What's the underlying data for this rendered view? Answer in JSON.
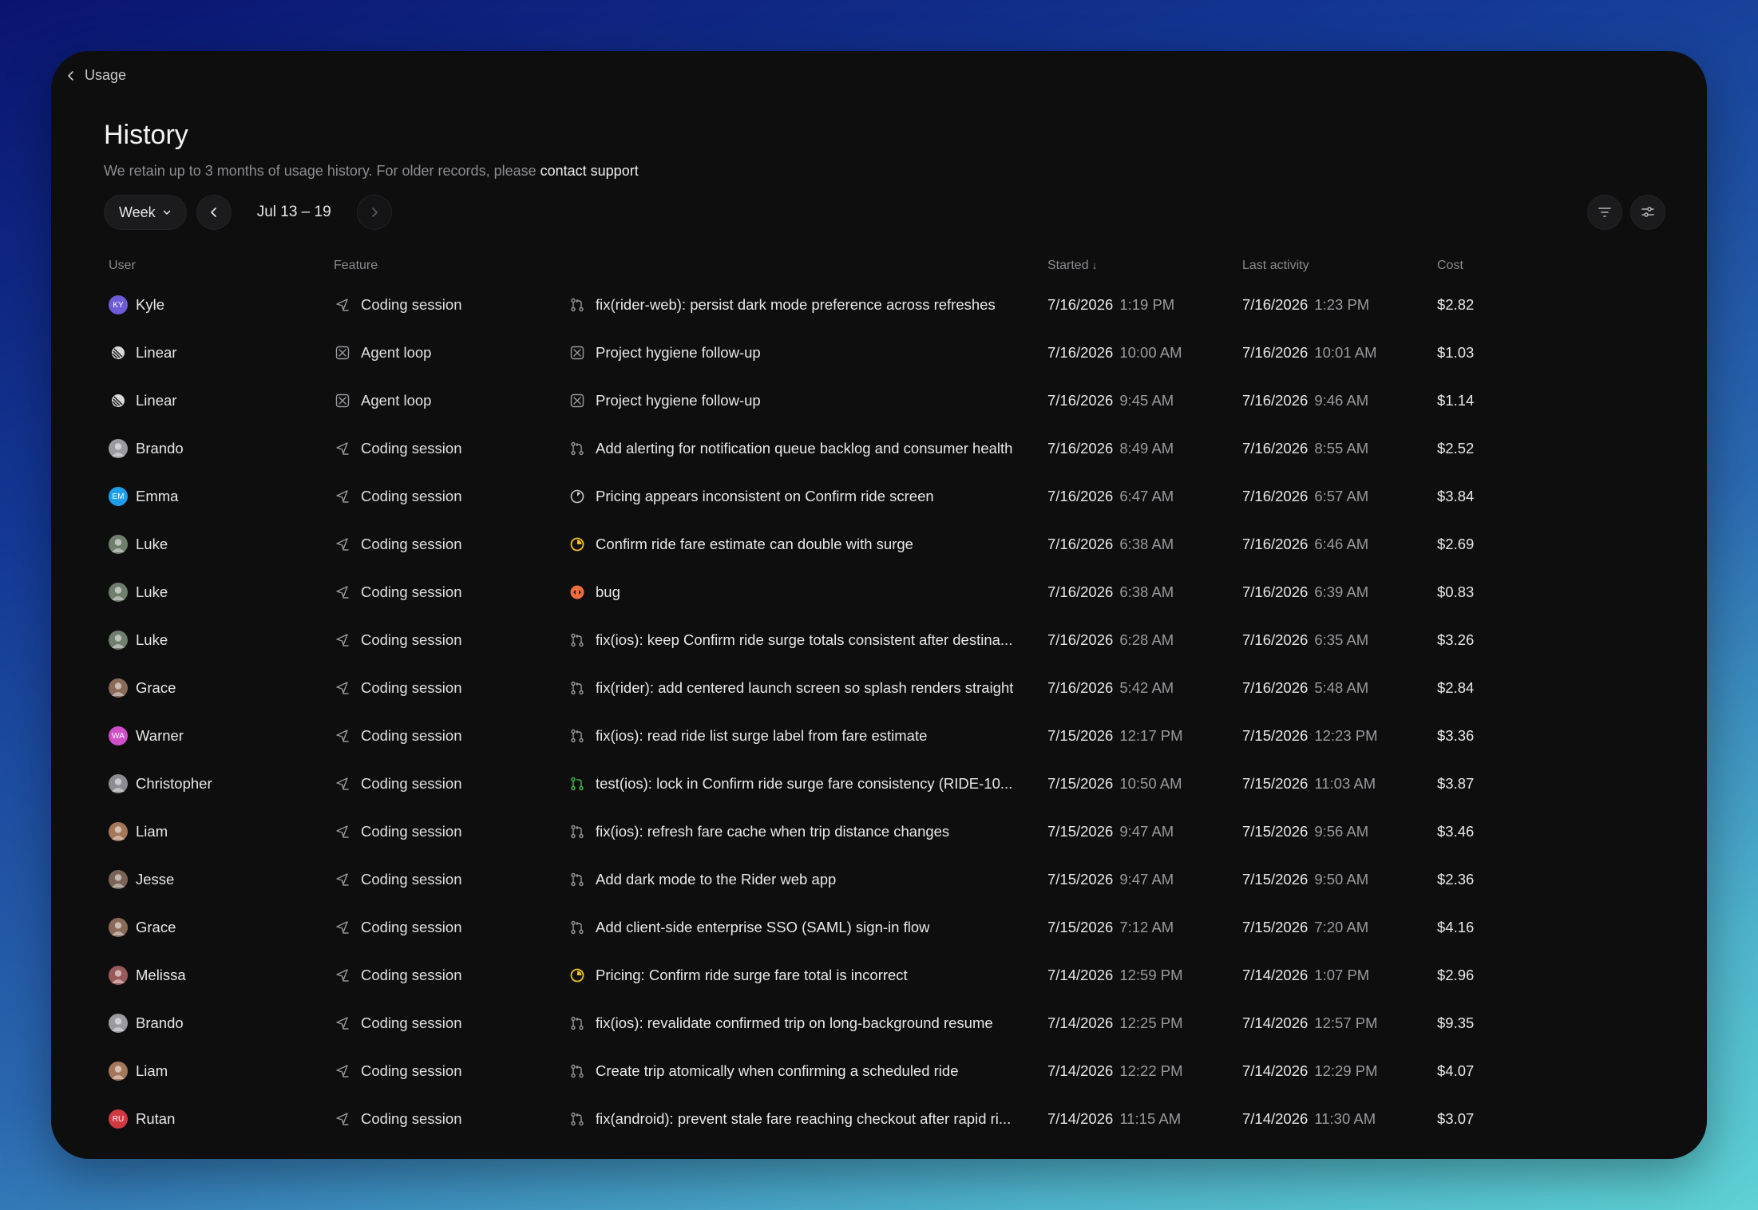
{
  "breadcrumb": {
    "label": "Usage"
  },
  "header": {
    "title": "History",
    "subtitle": "We retain up to 3 months of usage history. For older records, please",
    "link": "contact support"
  },
  "toolbar": {
    "period": "Week",
    "range": "Jul 13 – 19"
  },
  "columns": {
    "user": "User",
    "feature": "Feature",
    "started": "Started",
    "started_sort": "↓",
    "last": "Last activity",
    "cost": "Cost"
  },
  "rows": [
    {
      "user": "Kyle",
      "avatar": {
        "type": "initials",
        "text": "KY",
        "color": "#6e5bd6"
      },
      "feature": "Coding session",
      "feature_icon": "coding-icon",
      "title_icon": "pull-request-icon",
      "title": "fix(rider-web): persist dark mode preference across refreshes",
      "started_date": "7/16/2026",
      "started_time": "1:19 PM",
      "last_date": "7/16/2026",
      "last_time": "1:23 PM",
      "cost": "$2.82"
    },
    {
      "user": "Linear",
      "avatar": {
        "type": "logo",
        "text": "",
        "color": "#d8d8da"
      },
      "feature": "Agent loop",
      "feature_icon": "agent-loop-icon",
      "title_icon": "agent-loop-icon",
      "title": "Project hygiene follow-up",
      "started_date": "7/16/2026",
      "started_time": "10:00 AM",
      "last_date": "7/16/2026",
      "last_time": "10:01 AM",
      "cost": "$1.03"
    },
    {
      "user": "Linear",
      "avatar": {
        "type": "logo",
        "text": "",
        "color": "#d8d8da"
      },
      "feature": "Agent loop",
      "feature_icon": "agent-loop-icon",
      "title_icon": "agent-loop-icon",
      "title": "Project hygiene follow-up",
      "started_date": "7/16/2026",
      "started_time": "9:45 AM",
      "last_date": "7/16/2026",
      "last_time": "9:46 AM",
      "cost": "$1.14"
    },
    {
      "user": "Brando",
      "avatar": {
        "type": "photo",
        "text": "",
        "color": "#9a9aa0"
      },
      "feature": "Coding session",
      "feature_icon": "coding-icon",
      "title_icon": "pull-request-icon",
      "title": "Add alerting for notification queue backlog and consumer health",
      "started_date": "7/16/2026",
      "started_time": "8:49 AM",
      "last_date": "7/16/2026",
      "last_time": "8:55 AM",
      "cost": "$2.52"
    },
    {
      "user": "Emma",
      "avatar": {
        "type": "initials",
        "text": "EM",
        "color": "#1e9ee8"
      },
      "feature": "Coding session",
      "feature_icon": "coding-icon",
      "title_icon": "issue-open-icon",
      "title": "Pricing appears inconsistent on Confirm ride screen",
      "started_date": "7/16/2026",
      "started_time": "6:47 AM",
      "last_date": "7/16/2026",
      "last_time": "6:57 AM",
      "cost": "$3.84"
    },
    {
      "user": "Luke",
      "avatar": {
        "type": "photo",
        "text": "",
        "color": "#6f7f6c"
      },
      "feature": "Coding session",
      "feature_icon": "coding-icon",
      "title_icon": "issue-progress-icon",
      "title": "Confirm ride fare estimate can double with surge",
      "started_date": "7/16/2026",
      "started_time": "6:38 AM",
      "last_date": "7/16/2026",
      "last_time": "6:46 AM",
      "cost": "$2.69"
    },
    {
      "user": "Luke",
      "avatar": {
        "type": "photo",
        "text": "",
        "color": "#6f7f6c"
      },
      "feature": "Coding session",
      "feature_icon": "coding-icon",
      "title_icon": "urgent-issue-icon",
      "title": "bug",
      "started_date": "7/16/2026",
      "started_time": "6:38 AM",
      "last_date": "7/16/2026",
      "last_time": "6:39 AM",
      "cost": "$0.83"
    },
    {
      "user": "Luke",
      "avatar": {
        "type": "photo",
        "text": "",
        "color": "#6f7f6c"
      },
      "feature": "Coding session",
      "feature_icon": "coding-icon",
      "title_icon": "pull-request-icon",
      "title": "fix(ios): keep Confirm ride surge totals consistent after destina...",
      "started_date": "7/16/2026",
      "started_time": "6:28 AM",
      "last_date": "7/16/2026",
      "last_time": "6:35 AM",
      "cost": "$3.26"
    },
    {
      "user": "Grace",
      "avatar": {
        "type": "photo",
        "text": "",
        "color": "#8a6a58"
      },
      "feature": "Coding session",
      "feature_icon": "coding-icon",
      "title_icon": "pull-request-icon",
      "title": "fix(rider): add centered launch screen so splash renders straight",
      "started_date": "7/16/2026",
      "started_time": "5:42 AM",
      "last_date": "7/16/2026",
      "last_time": "5:48 AM",
      "cost": "$2.84"
    },
    {
      "user": "Warner",
      "avatar": {
        "type": "initials",
        "text": "WA",
        "color": "#d04ec8"
      },
      "feature": "Coding session",
      "feature_icon": "coding-icon",
      "title_icon": "pull-request-icon",
      "title": "fix(ios): read ride list surge label from fare estimate",
      "started_date": "7/15/2026",
      "started_time": "12:17 PM",
      "last_date": "7/15/2026",
      "last_time": "12:23 PM",
      "cost": "$3.36"
    },
    {
      "user": "Christopher",
      "avatar": {
        "type": "photo",
        "text": "",
        "color": "#8c8c92"
      },
      "feature": "Coding session",
      "feature_icon": "coding-icon",
      "title_icon": "pull-request-merged-icon",
      "title": "test(ios): lock in Confirm ride surge fare consistency (RIDE-10...",
      "started_date": "7/15/2026",
      "started_time": "10:50 AM",
      "last_date": "7/15/2026",
      "last_time": "11:03 AM",
      "cost": "$3.87"
    },
    {
      "user": "Liam",
      "avatar": {
        "type": "photo",
        "text": "",
        "color": "#a4765a"
      },
      "feature": "Coding session",
      "feature_icon": "coding-icon",
      "title_icon": "pull-request-icon",
      "title": "fix(ios): refresh fare cache when trip distance changes",
      "started_date": "7/15/2026",
      "started_time": "9:47 AM",
      "last_date": "7/15/2026",
      "last_time": "9:56 AM",
      "cost": "$3.46"
    },
    {
      "user": "Jesse",
      "avatar": {
        "type": "photo",
        "text": "",
        "color": "#7a6458"
      },
      "feature": "Coding session",
      "feature_icon": "coding-icon",
      "title_icon": "pull-request-icon",
      "title": "Add dark mode to the Rider web app",
      "started_date": "7/15/2026",
      "started_time": "9:47 AM",
      "last_date": "7/15/2026",
      "last_time": "9:50 AM",
      "cost": "$2.36"
    },
    {
      "user": "Grace",
      "avatar": {
        "type": "photo",
        "text": "",
        "color": "#8a6a58"
      },
      "feature": "Coding session",
      "feature_icon": "coding-icon",
      "title_icon": "pull-request-icon",
      "title": "Add client-side enterprise SSO (SAML) sign-in flow",
      "started_date": "7/15/2026",
      "started_time": "7:12 AM",
      "last_date": "7/15/2026",
      "last_time": "7:20 AM",
      "cost": "$4.16"
    },
    {
      "user": "Melissa",
      "avatar": {
        "type": "photo",
        "text": "",
        "color": "#9a5a5a"
      },
      "feature": "Coding session",
      "feature_icon": "coding-icon",
      "title_icon": "issue-progress-icon",
      "title": "Pricing: Confirm ride surge fare total is incorrect",
      "started_date": "7/14/2026",
      "started_time": "12:59 PM",
      "last_date": "7/14/2026",
      "last_time": "1:07 PM",
      "cost": "$2.96"
    },
    {
      "user": "Brando",
      "avatar": {
        "type": "photo",
        "text": "",
        "color": "#9a9aa0"
      },
      "feature": "Coding session",
      "feature_icon": "coding-icon",
      "title_icon": "pull-request-icon",
      "title": "fix(ios): revalidate confirmed trip on long-background resume",
      "started_date": "7/14/2026",
      "started_time": "12:25 PM",
      "last_date": "7/14/2026",
      "last_time": "12:57 PM",
      "cost": "$9.35"
    },
    {
      "user": "Liam",
      "avatar": {
        "type": "photo",
        "text": "",
        "color": "#a4765a"
      },
      "feature": "Coding session",
      "feature_icon": "coding-icon",
      "title_icon": "pull-request-icon",
      "title": "Create trip atomically when confirming a scheduled ride",
      "started_date": "7/14/2026",
      "started_time": "12:22 PM",
      "last_date": "7/14/2026",
      "last_time": "12:29 PM",
      "cost": "$4.07"
    },
    {
      "user": "Rutan",
      "avatar": {
        "type": "initials",
        "text": "RU",
        "color": "#d0393f"
      },
      "feature": "Coding session",
      "feature_icon": "coding-icon",
      "title_icon": "pull-request-icon",
      "title": "fix(android): prevent stale fare reaching checkout after rapid ri...",
      "started_date": "7/14/2026",
      "started_time": "11:15 AM",
      "last_date": "7/14/2026",
      "last_time": "11:30 AM",
      "cost": "$3.07"
    }
  ]
}
